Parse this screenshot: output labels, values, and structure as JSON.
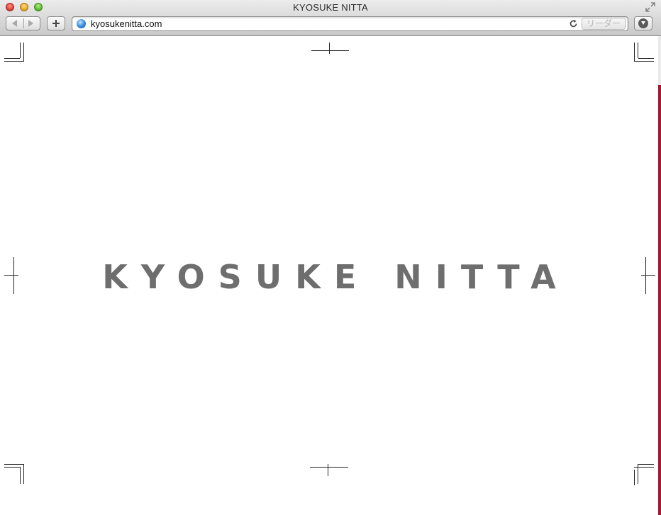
{
  "window": {
    "title": "KYOSUKE NITTA"
  },
  "toolbar": {
    "url": "kyosukenitta.com",
    "reader_label": "リーダー"
  },
  "icons": {
    "back": "back-arrow-icon",
    "forward": "forward-arrow-icon",
    "new_tab": "plus-icon",
    "site": "globe-icon",
    "reload": "reload-icon",
    "downloads": "download-icon",
    "fullscreen": "fullscreen-icon"
  },
  "colors": {
    "logo_text": "#6e6e6e",
    "scroll_accent": "#a8192c",
    "crop_marks": "#222222"
  },
  "page": {
    "logo_text": "KYOSUKE NITTA"
  }
}
